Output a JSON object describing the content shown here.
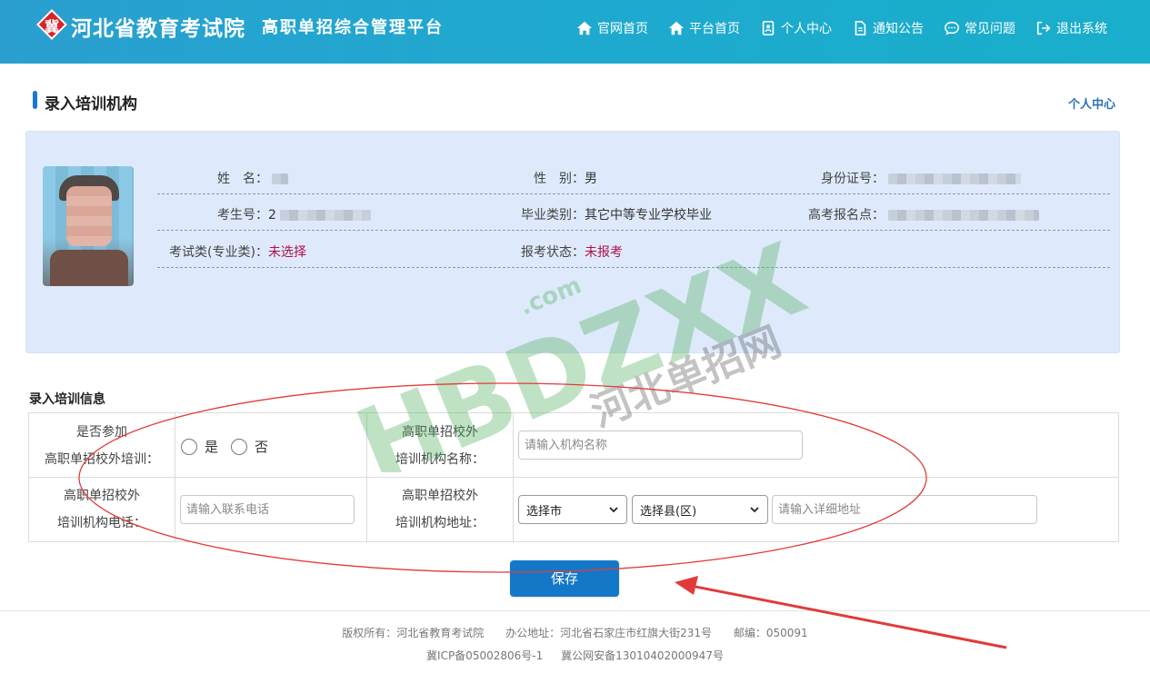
{
  "header": {
    "logo_glyph": "冀",
    "site_name": "河北省教育考试院",
    "platform_name": "高职单招综合管理平台",
    "nav": [
      {
        "label": "官网首页",
        "icon": "home-icon"
      },
      {
        "label": "平台首页",
        "icon": "home-icon"
      },
      {
        "label": "个人中心",
        "icon": "id-card-icon"
      },
      {
        "label": "通知公告",
        "icon": "document-icon"
      },
      {
        "label": "常见问题",
        "icon": "chat-icon"
      },
      {
        "label": "退出系统",
        "icon": "logout-icon"
      }
    ]
  },
  "page": {
    "title": "录入培训机构",
    "personal_link": "个人中心"
  },
  "profile": {
    "name_label": "姓　名：",
    "name_value": "",
    "gender_label": "性　别：",
    "gender_value": "男",
    "id_label": "身份证号：",
    "id_value": "",
    "exam_no_label": "考生号：",
    "exam_no_value": "2",
    "grad_type_label": "毕业类别：",
    "grad_type_value": "其它中等专业学校毕业",
    "site_label": "高考报名点：",
    "site_value": "",
    "exam_category_label": "考试类(专业类)：",
    "exam_category_value": "未选择",
    "status_label": "报考状态：",
    "status_value": "未报考"
  },
  "training": {
    "section_title": "录入培训信息",
    "participate_label_1": "是否参加",
    "participate_label_2": "高职单招校外培训：",
    "yes_label": "是",
    "no_label": "否",
    "org_name_label_1": "高职单招校外",
    "org_name_label_2": "培训机构名称：",
    "org_name_placeholder": "请输入机构名称",
    "phone_label_1": "高职单招校外",
    "phone_label_2": "培训机构电话：",
    "phone_placeholder": "请输入联系电话",
    "address_label_1": "高职单招校外",
    "address_label_2": "培训机构地址：",
    "city_select": "选择市",
    "county_select": "选择县(区)",
    "address_placeholder": "请输入详细地址",
    "save_label": "保存"
  },
  "footer": {
    "copyright": "版权所有：河北省教育考试院",
    "address": "办公地址：河北省石家庄市红旗大街231号",
    "postcode": "邮编：050091",
    "icp": "冀ICP备05002806号-1",
    "police": "冀公网安备13010402000947号"
  },
  "watermark": {
    "brand": "HBDZXX",
    "domain": ".com",
    "cn_name": "河北单招网"
  },
  "colors": {
    "header": "#1fa9cf",
    "accent": "#1478c9",
    "panel": "#deeafb",
    "annotation_red": "#e23a3a"
  }
}
